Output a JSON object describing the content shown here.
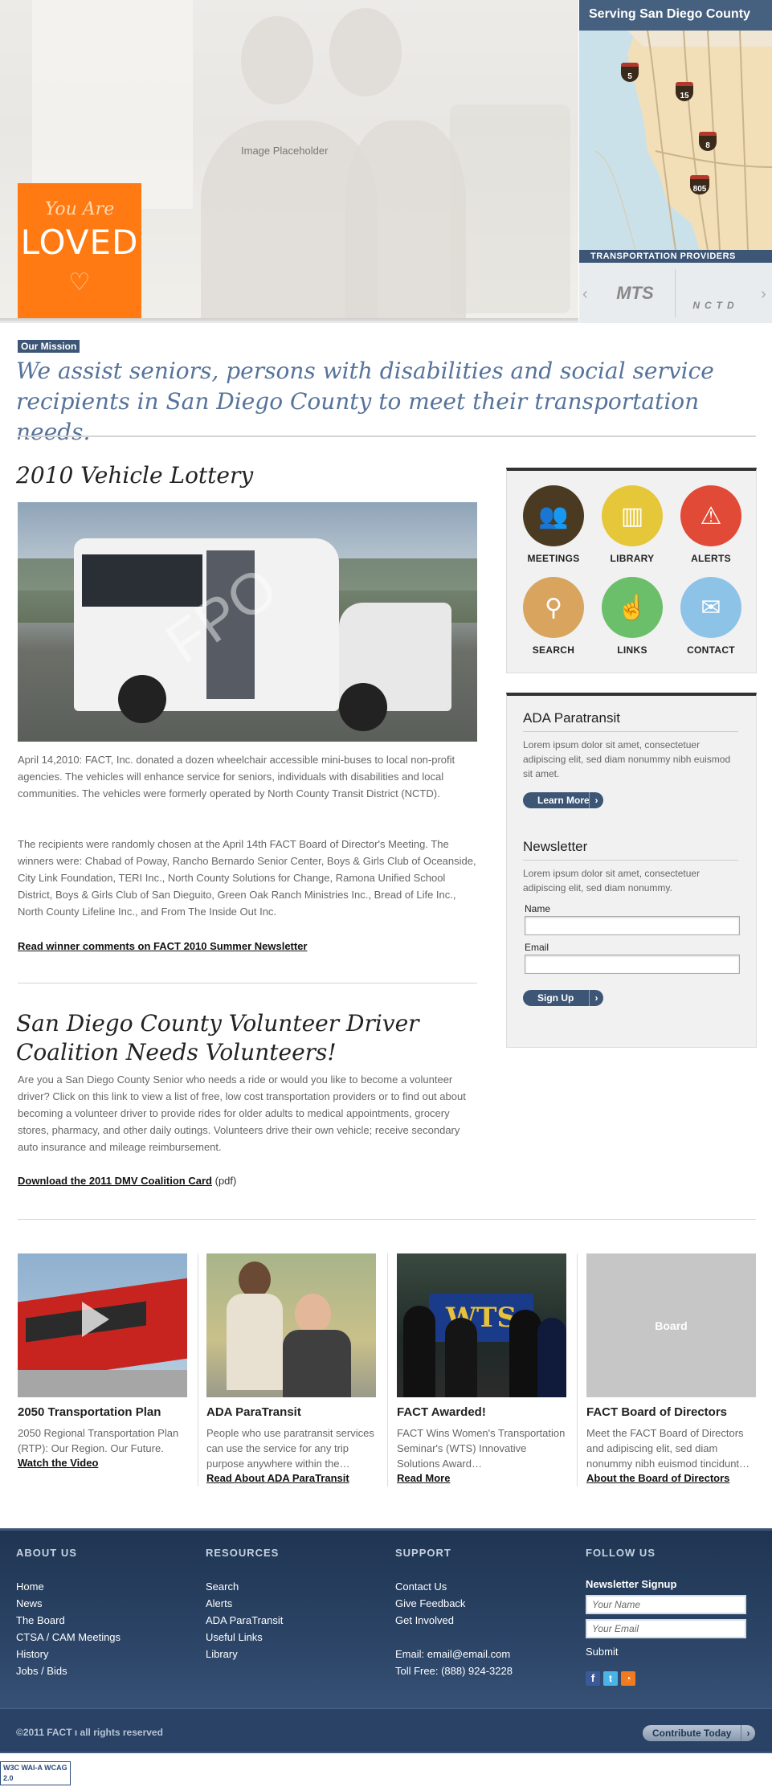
{
  "hero": {
    "placeholder": "Image Placeholder",
    "badge_top": "You Are",
    "badge_main": "LOVED"
  },
  "map": {
    "title": "Serving San Diego County",
    "highways": [
      "5",
      "15",
      "8",
      "805"
    ],
    "providers_label": "TRANSPORTATION PROVIDERS",
    "provider_logos": [
      "MTS",
      "NCTD"
    ]
  },
  "mission": {
    "label": "Our Mission",
    "text": "We assist seniors, persons with disabilities and social service recipients in San Diego County to meet their transportation needs."
  },
  "lottery": {
    "title": "2010 Vehicle Lottery",
    "image_watermark": "FPO",
    "para1": "April 14,2010: FACT, Inc. donated a dozen wheelchair accessible mini-buses to local non-profit agencies. The vehicles will enhance service for seniors, individuals with disabilities and local communities. The vehicles were formerly operated by North County Transit District (NCTD).",
    "para2": "The recipients were randomly chosen at the April 14th FACT Board of Director's Meeting. The winners were: Chabad of Poway, Rancho Bernardo Senior Center, Boys & Girls Club of Oceanside, City Link Foundation, TERI Inc., North County Solutions for Change, Ramona Unified School District, Boys & Girls Club of San Dieguito, Green Oak Ranch Ministries Inc., Bread of Life Inc., North County Lifeline Inc., and From The Inside Out Inc.",
    "link": "Read winner comments on FACT 2010 Summer Newsletter"
  },
  "volunteer": {
    "title": "San Diego County Volunteer Driver Coalition Needs Volunteers!",
    "para": "Are you a San Diego County Senior who needs a ride or would you like to become a volunteer driver? Click on this link to view a list of free, low cost transportation providers or to find out about becoming a volunteer driver to provide rides for older adults to medical appointments, grocery stores, pharmacy, and other daily outings. Volunteers drive their own vehicle; receive secondary auto insurance and mileage reimbursement.",
    "link": "Download the 2011 DMV Coalition Card",
    "link_suffix": "(pdf)"
  },
  "quick_links": [
    {
      "label": "MEETINGS",
      "color": "#4a3a22"
    },
    {
      "label": "LIBRARY",
      "color": "#e6c73a"
    },
    {
      "label": "ALERTS",
      "color": "#e04a36"
    },
    {
      "label": "SEARCH",
      "color": "#d9a45e"
    },
    {
      "label": "LINKS",
      "color": "#6cbf6a"
    },
    {
      "label": "CONTACT",
      "color": "#8ec3e8"
    }
  ],
  "ada_box": {
    "title": "ADA Paratransit",
    "text": "Lorem ipsum dolor sit amet, consectetuer adipiscing elit, sed diam nonummy nibh euismod sit amet.",
    "button": "Learn More"
  },
  "newsletter": {
    "title": "Newsletter",
    "text": "Lorem ipsum dolor sit amet, consectetuer adipiscing elit, sed diam nonummy.",
    "name_label": "Name",
    "email_label": "Email",
    "button": "Sign Up"
  },
  "features": [
    {
      "title": "2050 Transportation Plan",
      "desc": "2050 Regional Transportation Plan (RTP): Our Region. Our Future.",
      "link": "Watch the Video"
    },
    {
      "title": "ADA ParaTransit",
      "desc": "People who use paratransit services can use the service for any trip purpose anywhere within the…",
      "link": "Read About ADA ParaTransit"
    },
    {
      "title": "FACT Awarded!",
      "desc": "FACT Wins Women's Transportation Seminar's (WTS) Innovative Solutions Award…",
      "link": "Read More",
      "image_text": "WTS"
    },
    {
      "title": "FACT Board of Directors",
      "desc": "Meet the FACT Board of Directors and adipiscing elit, sed diam nonummy nibh euismod tincidunt…",
      "link": "About the Board of Directors",
      "image_text": "Board"
    }
  ],
  "footer": {
    "about": {
      "heading": "ABOUT US",
      "items": [
        "Home",
        "News",
        "The Board",
        "CTSA / CAM Meetings",
        "History",
        "Jobs / Bids"
      ]
    },
    "resources": {
      "heading": "RESOURCES",
      "items": [
        "Search",
        "Alerts",
        "ADA ParaTransit",
        "Useful Links",
        "Library"
      ]
    },
    "support": {
      "heading": "SUPPORT",
      "items": [
        "Contact Us",
        "Give Feedback",
        "Get Involved"
      ],
      "email": "Email: email@email.com",
      "phone": "Toll Free: (888) 924-3228"
    },
    "follow": {
      "heading": "FOLLOW US",
      "signup_title": "Newsletter Signup",
      "name_placeholder": "Your Name",
      "email_placeholder": "Your Email",
      "submit": "Submit"
    },
    "copyright": "©2011 FACT  ı  all rights reserved",
    "contribute": "Contribute Today",
    "w3c_badge": "W3C WAI-A WCAG 2.0"
  }
}
